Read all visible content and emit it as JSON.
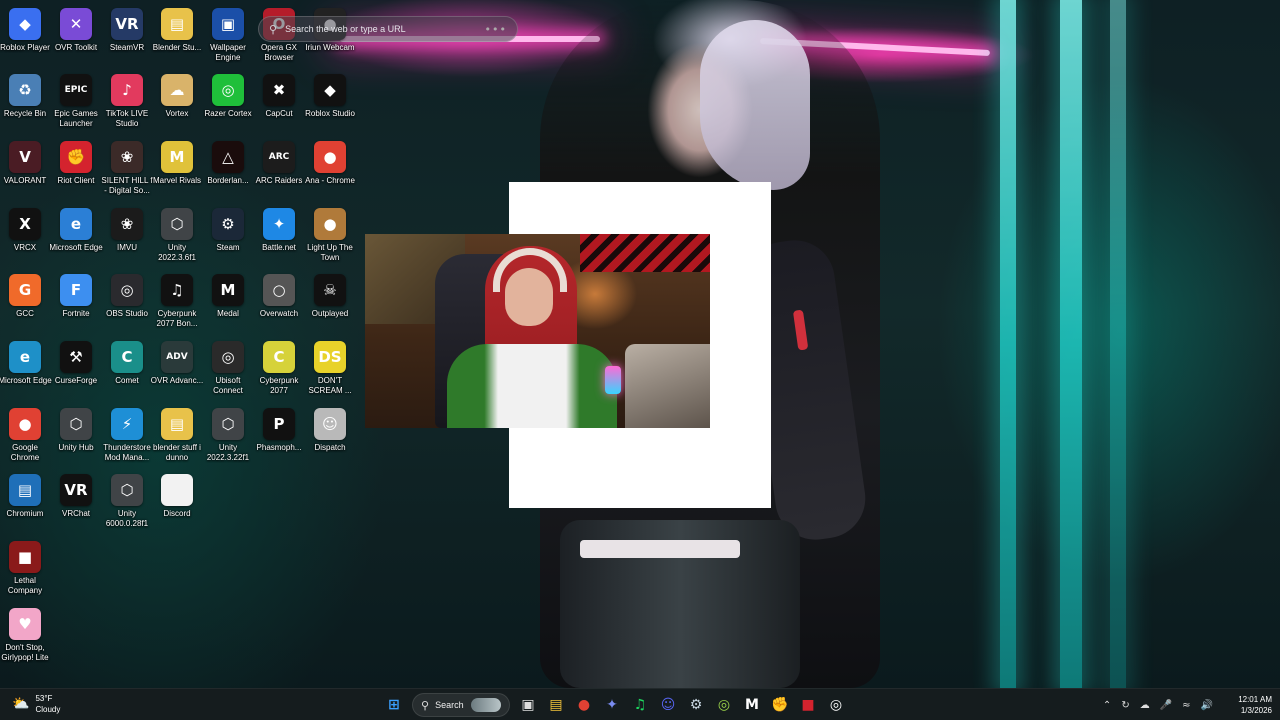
{
  "search_bar": {
    "placeholder": "Search the web or type a URL",
    "more": "•••"
  },
  "desktop_icons": [
    {
      "label": "Roblox Player",
      "color": "#3a6ff0",
      "glyph": "◆"
    },
    {
      "label": "OVR Toolkit",
      "color": "#7a4bd6",
      "glyph": "✕"
    },
    {
      "label": "SteamVR",
      "color": "#253a66",
      "glyph": "VR"
    },
    {
      "label": "Blender Stu...",
      "color": "#e8c24a",
      "glyph": "▤"
    },
    {
      "label": "Wallpaper Engine",
      "color": "#1b4fa8",
      "glyph": "▣"
    },
    {
      "label": "Opera GX Browser",
      "color": "#b51c2a",
      "glyph": "O"
    },
    {
      "label": "Iriun Webcam",
      "color": "#222",
      "glyph": "●"
    },
    {
      "label": "Recycle Bin",
      "color": "#4a7fb5",
      "glyph": "♻"
    },
    {
      "label": "Epic Games Launcher",
      "color": "#111",
      "glyph": "EPIC"
    },
    {
      "label": "TikTok LIVE Studio",
      "color": "#e23a5e",
      "glyph": "♪"
    },
    {
      "label": "Vortex",
      "color": "#d9b36a",
      "glyph": "☁"
    },
    {
      "label": "Razer Cortex",
      "color": "#1fbf3a",
      "glyph": "◎"
    },
    {
      "label": "CapCut",
      "color": "#111",
      "glyph": "✖"
    },
    {
      "label": "Roblox Studio",
      "color": "#111",
      "glyph": "◆"
    },
    {
      "label": "VALORANT",
      "color": "#4a1c24",
      "glyph": "V"
    },
    {
      "label": "Riot Client",
      "color": "#d4232e",
      "glyph": "✊"
    },
    {
      "label": "SILENT HILL f - Digital So...",
      "color": "#3b2a28",
      "glyph": "❀"
    },
    {
      "label": "Marvel Rivals",
      "color": "#e0c23a",
      "glyph": "M"
    },
    {
      "label": "Borderlan...",
      "color": "#1a0c0c",
      "glyph": "△"
    },
    {
      "label": "ARC Raiders",
      "color": "#1c1c1c",
      "glyph": "ARC"
    },
    {
      "label": "Ana - Chrome",
      "color": "#e04133",
      "glyph": "●"
    },
    {
      "label": "VRCX",
      "color": "#111",
      "glyph": "X"
    },
    {
      "label": "Microsoft Edge",
      "color": "#2b7fd6",
      "glyph": "e"
    },
    {
      "label": "IMVU",
      "color": "#1b1b1b",
      "glyph": "❀"
    },
    {
      "label": "Unity 2022.3.6f1",
      "color": "#404447",
      "glyph": "⬡"
    },
    {
      "label": "Steam",
      "color": "#1b2838",
      "glyph": "⚙"
    },
    {
      "label": "Battle.net",
      "color": "#1e88e5",
      "glyph": "✦"
    },
    {
      "label": "Light Up The Town",
      "color": "#b07a3a",
      "glyph": "●"
    },
    {
      "label": "GCC",
      "color": "#f06a2a",
      "glyph": "G"
    },
    {
      "label": "Fortnite",
      "color": "#3d8ff0",
      "glyph": "F"
    },
    {
      "label": "OBS Studio",
      "color": "#2a2a2e",
      "glyph": "◎"
    },
    {
      "label": "Cyberpunk 2077 Bon...",
      "color": "#111",
      "glyph": "♫"
    },
    {
      "label": "Medal",
      "color": "#111",
      "glyph": "M"
    },
    {
      "label": "Overwatch",
      "color": "#555",
      "glyph": "○"
    },
    {
      "label": "Outplayed",
      "color": "#111",
      "glyph": "☠"
    },
    {
      "label": "Microsoft Edge",
      "color": "#1e90c8",
      "glyph": "e"
    },
    {
      "label": "CurseForge",
      "color": "#111",
      "glyph": "⚒"
    },
    {
      "label": "Comet",
      "color": "#1a8f8a",
      "glyph": "C"
    },
    {
      "label": "OVR Advanc...",
      "color": "#2a3a3a",
      "glyph": "ADV"
    },
    {
      "label": "Ubisoft Connect",
      "color": "#2a2a2a",
      "glyph": "◎"
    },
    {
      "label": "Cyberpunk 2077",
      "color": "#d6d23a",
      "glyph": "C"
    },
    {
      "label": "DON'T SCREAM ...",
      "color": "#e8d22a",
      "glyph": "DS"
    },
    {
      "label": "Google Chrome",
      "color": "#e04133",
      "glyph": "●"
    },
    {
      "label": "Unity Hub",
      "color": "#404447",
      "glyph": "⬡"
    },
    {
      "label": "Thunderstore Mod Mana...",
      "color": "#1e8fd6",
      "glyph": "⚡"
    },
    {
      "label": "blender stuff i dunno",
      "color": "#e8c24a",
      "glyph": "▤"
    },
    {
      "label": "Unity 2022.3.22f1",
      "color": "#404447",
      "glyph": "⬡"
    },
    {
      "label": "Phasmoph...",
      "color": "#111",
      "glyph": "P"
    },
    {
      "label": "Dispatch",
      "color": "#b9b9b9",
      "glyph": "☺"
    },
    {
      "label": "Chromium",
      "color": "#1f6fb8",
      "glyph": "▤"
    },
    {
      "label": "VRChat",
      "color": "#111",
      "glyph": "VR"
    },
    {
      "label": "Unity 6000.0.28f1",
      "color": "#404447",
      "glyph": "⬡"
    },
    {
      "label": "Discord",
      "color": "#f2f2f2",
      "glyph": ""
    },
    {
      "label": "Lethal Company",
      "color": "#8a1a1a",
      "glyph": "■"
    },
    {
      "label": "Don't Stop, Girlypop! Lite",
      "color": "#f2a6c8",
      "glyph": "♥"
    }
  ],
  "taskbar": {
    "weather": {
      "temp": "53°F",
      "condition": "Cloudy",
      "icon": "cloud-sun-icon"
    },
    "search_label": "Search",
    "clock": {
      "time": "12:01 AM",
      "date": "1/3/2026"
    },
    "pinned": [
      {
        "name": "start-icon",
        "glyph": "⊞",
        "color": "#3aa0ff"
      },
      {
        "name": "task-view-icon",
        "glyph": "▣",
        "color": "#ddd"
      },
      {
        "name": "file-explorer-icon",
        "glyph": "▤",
        "color": "#f0c23a"
      },
      {
        "name": "chrome-icon",
        "glyph": "●",
        "color": "#e04133"
      },
      {
        "name": "copilot-icon",
        "glyph": "✦",
        "color": "#7a8cf0"
      },
      {
        "name": "spotify-icon",
        "glyph": "♫",
        "color": "#1ed760"
      },
      {
        "name": "discord-icon",
        "glyph": "☺",
        "color": "#5865f2"
      },
      {
        "name": "steam-icon",
        "glyph": "⚙",
        "color": "#c7d5e0"
      },
      {
        "name": "xbox-icon",
        "glyph": "◎",
        "color": "#9bd44a"
      },
      {
        "name": "medal-icon",
        "glyph": "M",
        "color": "#ffffff"
      },
      {
        "name": "riot-icon",
        "glyph": "✊",
        "color": "#d4232e"
      },
      {
        "name": "app-red-icon",
        "glyph": "■",
        "color": "#d4232e"
      },
      {
        "name": "obs-icon",
        "glyph": "◎",
        "color": "#ffffff"
      }
    ],
    "tray": [
      "chevron-up-icon",
      "sync-icon",
      "cloud-icon",
      "microphone-icon",
      "wifi-icon",
      "volume-icon"
    ]
  }
}
